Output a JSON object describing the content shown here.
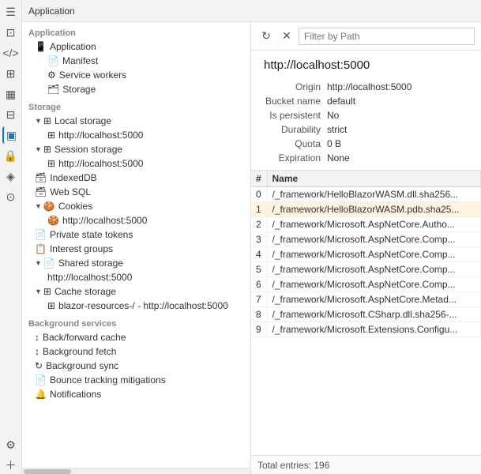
{
  "app": {
    "title": "Application"
  },
  "iconRail": {
    "icons": [
      {
        "name": "elements-icon",
        "symbol": "☰",
        "active": false
      },
      {
        "name": "console-icon",
        "symbol": "⊡",
        "active": false
      },
      {
        "name": "sources-icon",
        "symbol": "◱",
        "active": false
      },
      {
        "name": "network-icon",
        "symbol": "</>",
        "active": false
      },
      {
        "name": "performance-icon",
        "symbol": "⊞",
        "active": false
      },
      {
        "name": "memory-icon",
        "symbol": "⊟",
        "active": false
      },
      {
        "name": "application-icon",
        "symbol": "▣",
        "active": true
      },
      {
        "name": "security-icon",
        "symbol": "🔒",
        "active": false
      },
      {
        "name": "lighthouse-icon",
        "symbol": "◈",
        "active": false
      },
      {
        "name": "recorder-icon",
        "symbol": "⊙",
        "active": false
      }
    ]
  },
  "sidebar": {
    "sections": [
      {
        "label": "Application",
        "items": [
          {
            "id": "application-label",
            "text": "Application",
            "indent": 0,
            "icon": ""
          },
          {
            "id": "manifest",
            "text": "Manifest",
            "indent": 1,
            "icon": "📄"
          },
          {
            "id": "service-workers",
            "text": "Service workers",
            "indent": 1,
            "icon": "⚙"
          },
          {
            "id": "storage",
            "text": "Storage",
            "indent": 1,
            "icon": "🗂"
          }
        ]
      },
      {
        "label": "Storage",
        "items": [
          {
            "id": "local-storage",
            "text": "Local storage",
            "indent": 1,
            "icon": "⊞",
            "expanded": true,
            "triangle": "▼"
          },
          {
            "id": "local-storage-url",
            "text": "http://localhost:5000",
            "indent": 2,
            "icon": "⊞"
          },
          {
            "id": "session-storage",
            "text": "Session storage",
            "indent": 1,
            "icon": "⊞",
            "expanded": true,
            "triangle": "▼"
          },
          {
            "id": "session-storage-url",
            "text": "http://localhost:5000",
            "indent": 2,
            "icon": "⊞"
          },
          {
            "id": "indexeddb",
            "text": "IndexedDB",
            "indent": 1,
            "icon": "🗃"
          },
          {
            "id": "web-sql",
            "text": "Web SQL",
            "indent": 1,
            "icon": "🗃"
          },
          {
            "id": "cookies",
            "text": "Cookies",
            "indent": 1,
            "icon": "🍪",
            "expanded": true,
            "triangle": "▼"
          },
          {
            "id": "cookies-url",
            "text": "http://localhost:5000",
            "indent": 2,
            "icon": "🍪"
          },
          {
            "id": "private-state",
            "text": "Private state tokens",
            "indent": 1,
            "icon": "📄"
          },
          {
            "id": "interest-groups",
            "text": "Interest groups",
            "indent": 1,
            "icon": "📋"
          },
          {
            "id": "shared-storage",
            "text": "Shared storage",
            "indent": 1,
            "icon": "📄",
            "expanded": true,
            "triangle": "▼"
          },
          {
            "id": "shared-storage-url",
            "text": "http://localhost:5000",
            "indent": 2,
            "icon": ""
          },
          {
            "id": "cache-storage",
            "text": "Cache storage",
            "indent": 1,
            "icon": "⊞",
            "expanded": true,
            "triangle": "▼"
          },
          {
            "id": "cache-storage-url",
            "text": "blazor-resources-/ - http://localhost:5000",
            "indent": 2,
            "icon": "⊞"
          }
        ]
      },
      {
        "label": "Background services",
        "items": [
          {
            "id": "back-forward",
            "text": "Back/forward cache",
            "indent": 1,
            "icon": "↕"
          },
          {
            "id": "background-fetch",
            "text": "Background fetch",
            "indent": 1,
            "icon": "↕"
          },
          {
            "id": "background-sync",
            "text": "Background sync",
            "indent": 1,
            "icon": "↻"
          },
          {
            "id": "bounce-tracking",
            "text": "Bounce tracking mitigations",
            "indent": 1,
            "icon": "📄"
          },
          {
            "id": "notifications",
            "text": "Notifications",
            "indent": 1,
            "icon": "🔔"
          }
        ]
      }
    ]
  },
  "rightPanel": {
    "toolbar": {
      "refreshLabel": "↻",
      "clearLabel": "✕",
      "filterPlaceholder": "Filter by Path"
    },
    "info": {
      "title": "http://localhost:5000",
      "fields": [
        {
          "label": "Origin",
          "value": "http://localhost:5000"
        },
        {
          "label": "Bucket name",
          "value": "default"
        },
        {
          "label": "Is persistent",
          "value": "No"
        },
        {
          "label": "Durability",
          "value": "strict"
        },
        {
          "label": "Quota",
          "value": "0 B"
        },
        {
          "label": "Expiration",
          "value": "None"
        }
      ]
    },
    "table": {
      "columns": [
        "#",
        "Name"
      ],
      "rows": [
        {
          "num": "0",
          "name": "/_framework/HelloBlazorWASM.dll.sha256...",
          "selected": false
        },
        {
          "num": "1",
          "name": "/_framework/HelloBlazorWASM.pdb.sha25...",
          "selected": true
        },
        {
          "num": "2",
          "name": "/_framework/Microsoft.AspNetCore.Autho...",
          "selected": false
        },
        {
          "num": "3",
          "name": "/_framework/Microsoft.AspNetCore.Comp...",
          "selected": false
        },
        {
          "num": "4",
          "name": "/_framework/Microsoft.AspNetCore.Comp...",
          "selected": false
        },
        {
          "num": "5",
          "name": "/_framework/Microsoft.AspNetCore.Comp...",
          "selected": false
        },
        {
          "num": "6",
          "name": "/_framework/Microsoft.AspNetCore.Comp...",
          "selected": false
        },
        {
          "num": "7",
          "name": "/_framework/Microsoft.AspNetCore.Metad...",
          "selected": false
        },
        {
          "num": "8",
          "name": "/_framework/Microsoft.CSharp.dll.sha256-...",
          "selected": false
        },
        {
          "num": "9",
          "name": "/_framework/Microsoft.Extensions.Configu...",
          "selected": false
        }
      ],
      "totalEntries": "Total entries: 196"
    }
  }
}
